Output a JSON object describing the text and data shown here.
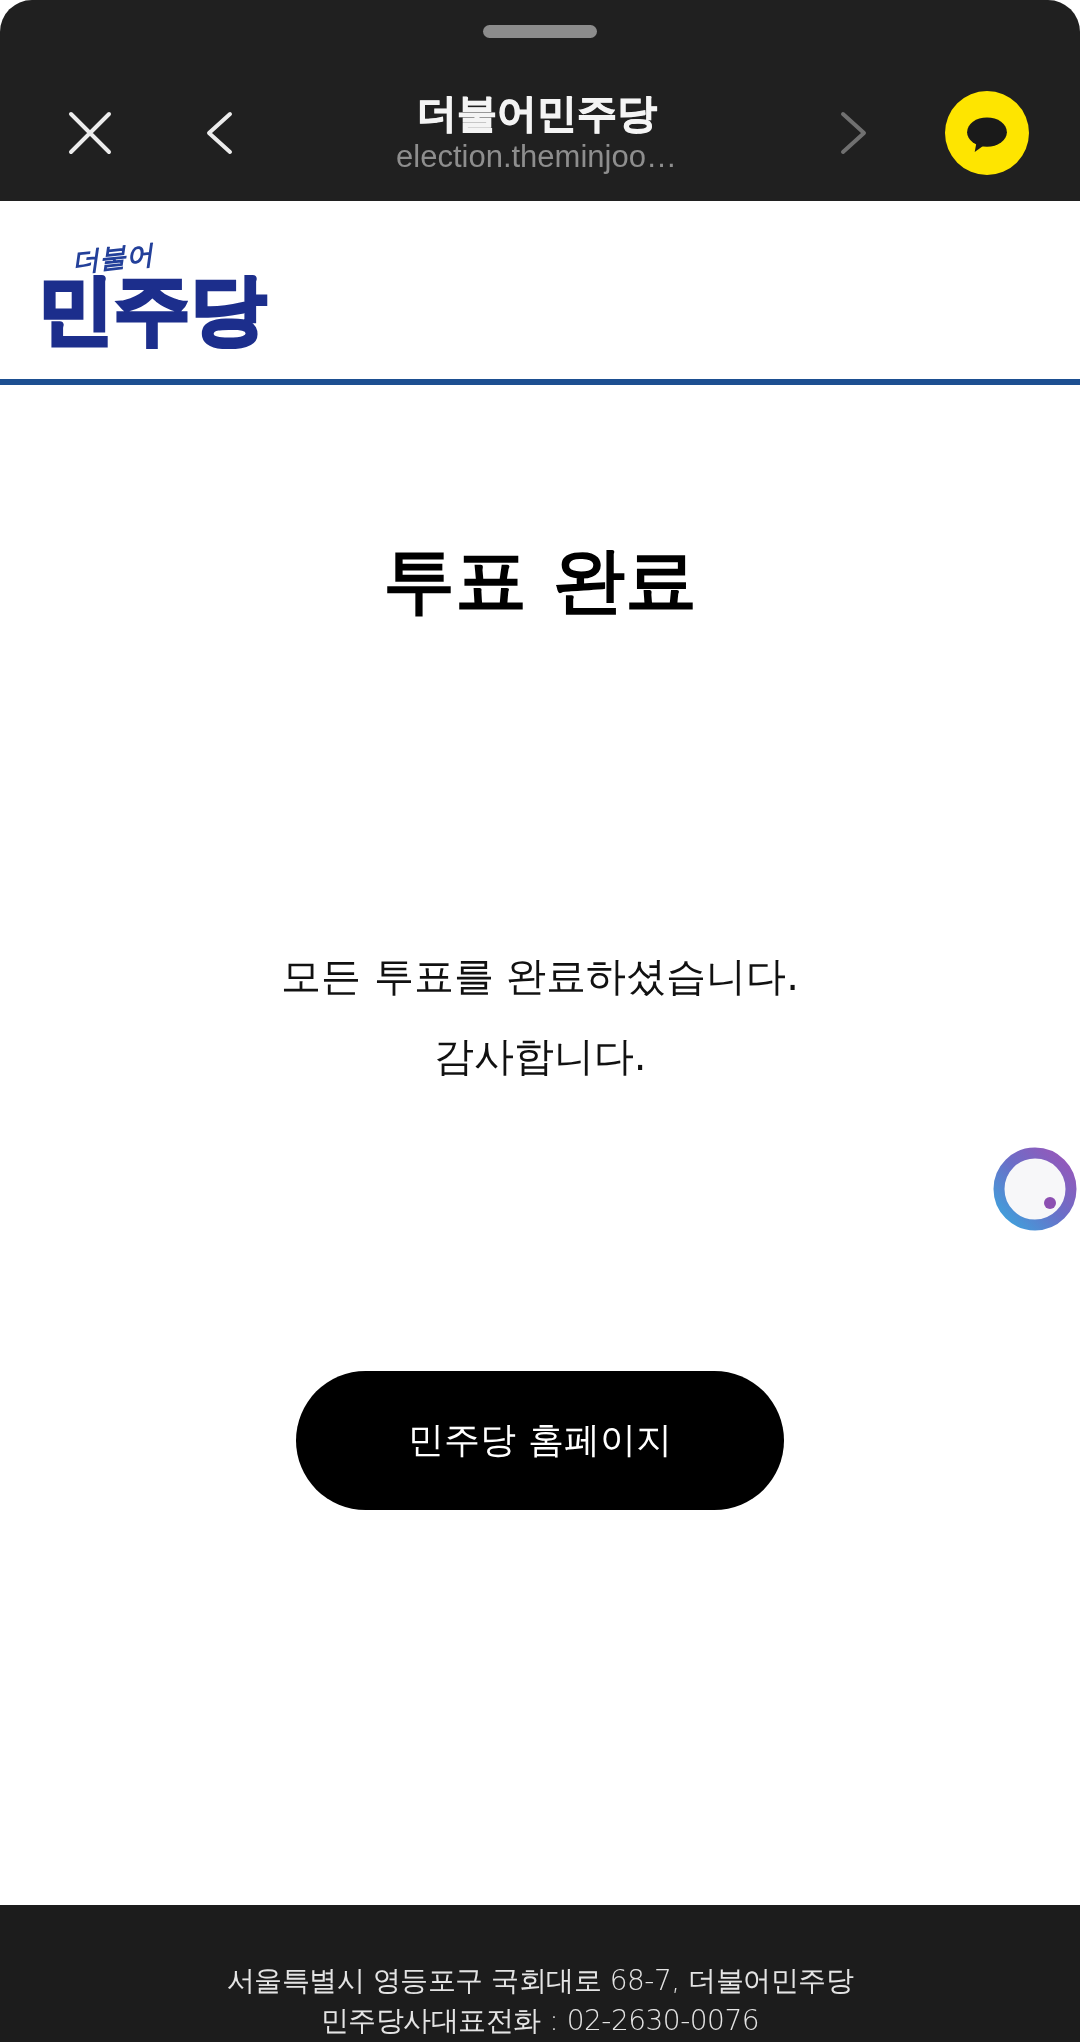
{
  "toolbar": {
    "title": "더불어민주당",
    "url": "election.theminjoo…",
    "back": {
      "disabled": false
    },
    "forward": {
      "disabled": true
    }
  },
  "site_header": {
    "logo": {
      "script_text": "더불어",
      "main_text": "민주당"
    }
  },
  "content": {
    "heading": "투표 완료",
    "message_lines": [
      "모든 투표를 완료하셨습니다.",
      "감사합니다."
    ],
    "button": "민주당 홈페이지"
  },
  "footer": {
    "lines": [
      "서울특별시 영등포구 국회대로 68-7, 더불어민주당",
      "민주당사대표전화 : 02-2630-0076"
    ]
  }
}
